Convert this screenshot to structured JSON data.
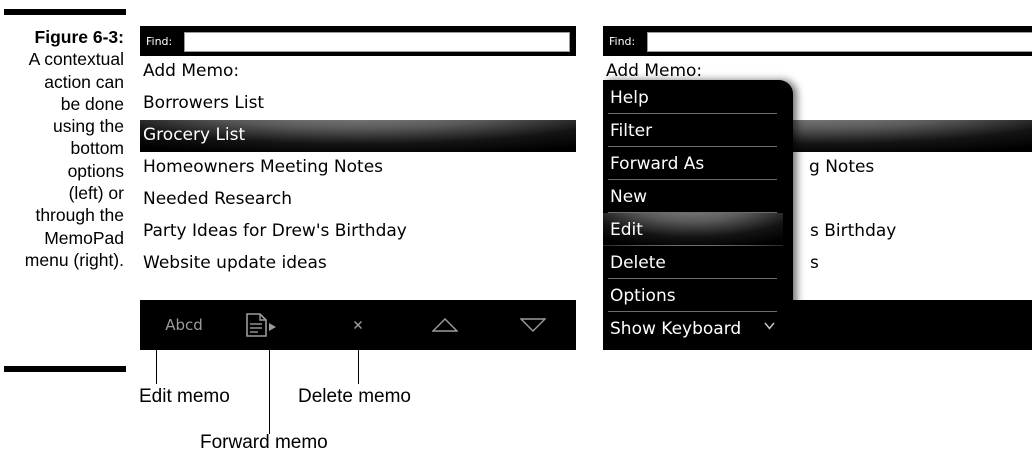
{
  "caption": {
    "figure": "Figure 6-3:",
    "lines": [
      "A contextual",
      "action can",
      "be done",
      "using the",
      "bottom",
      "options",
      "(left) or",
      "through the",
      "MemoPad",
      "menu (right)."
    ]
  },
  "left_screen": {
    "find_label": "Find:",
    "find_value": "",
    "items": [
      "Add Memo:",
      "Borrowers List",
      "Grocery List",
      "Homeowners Meeting Notes",
      "Needed Research",
      "Party Ideas for Drew's Birthday",
      "Website update ideas"
    ],
    "selected_item": "Grocery List",
    "bottom_bar": {
      "edit_label": "Abcd",
      "forward_icon": "forward-memo-icon",
      "delete_icon": "delete-x-icon",
      "up_icon": "arrow-up-icon",
      "down_icon": "arrow-down-icon"
    }
  },
  "right_screen": {
    "find_label": "Find:",
    "find_value": "",
    "background_items": [
      "Add Memo:",
      "",
      "",
      "g Notes",
      "",
      "s Birthday",
      "s"
    ],
    "menu": {
      "items": [
        "Help",
        "Filter",
        "Forward As",
        "New",
        "Edit",
        "Delete",
        "Options",
        "Show Keyboard"
      ],
      "active": "Edit",
      "more_icon": "chevron-down-icon"
    }
  },
  "annotations": {
    "edit": "Edit memo",
    "delete": "Delete memo",
    "forward": "Forward memo"
  },
  "colors": {
    "bar": "#000000",
    "icon_gray": "#9c9c9c",
    "selection_highlight": "#585858"
  }
}
